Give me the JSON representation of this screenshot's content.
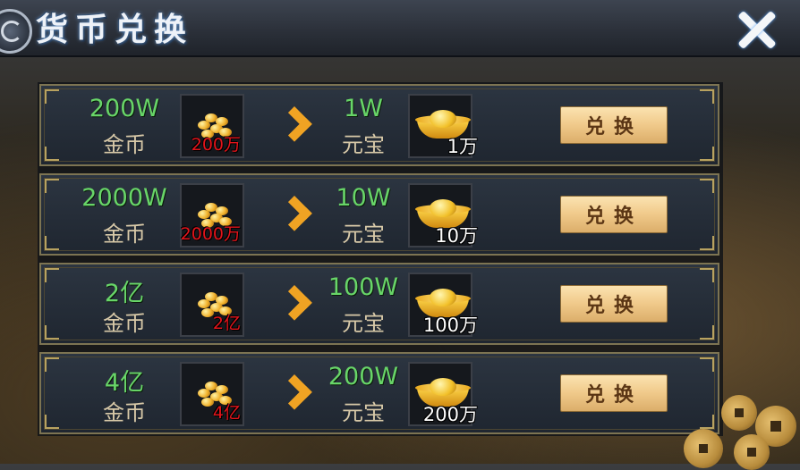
{
  "header": {
    "title": "货币兑换",
    "close_icon": "close-icon"
  },
  "exchange_rows": [
    {
      "src_amount": "200W",
      "src_currency": "金币",
      "src_item_count": "200万",
      "dst_amount": "1W",
      "dst_currency": "元宝",
      "dst_item_count": "1万",
      "button_label": "兑换"
    },
    {
      "src_amount": "2000W",
      "src_currency": "金币",
      "src_item_count": "2000万",
      "dst_amount": "10W",
      "dst_currency": "元宝",
      "dst_item_count": "10万",
      "button_label": "兑换"
    },
    {
      "src_amount": "2亿",
      "src_currency": "金币",
      "src_item_count": "2亿",
      "dst_amount": "100W",
      "dst_currency": "元宝",
      "dst_item_count": "100万",
      "button_label": "兑换"
    },
    {
      "src_amount": "4亿",
      "src_currency": "金币",
      "src_item_count": "4亿",
      "dst_amount": "200W",
      "dst_currency": "元宝",
      "dst_item_count": "200万",
      "button_label": "兑换"
    }
  ],
  "colors": {
    "amount_green": "#68d568",
    "item_count_red": "#e3141b",
    "arrow_orange": "#f0a323",
    "button_bg": "#f0c98a"
  }
}
